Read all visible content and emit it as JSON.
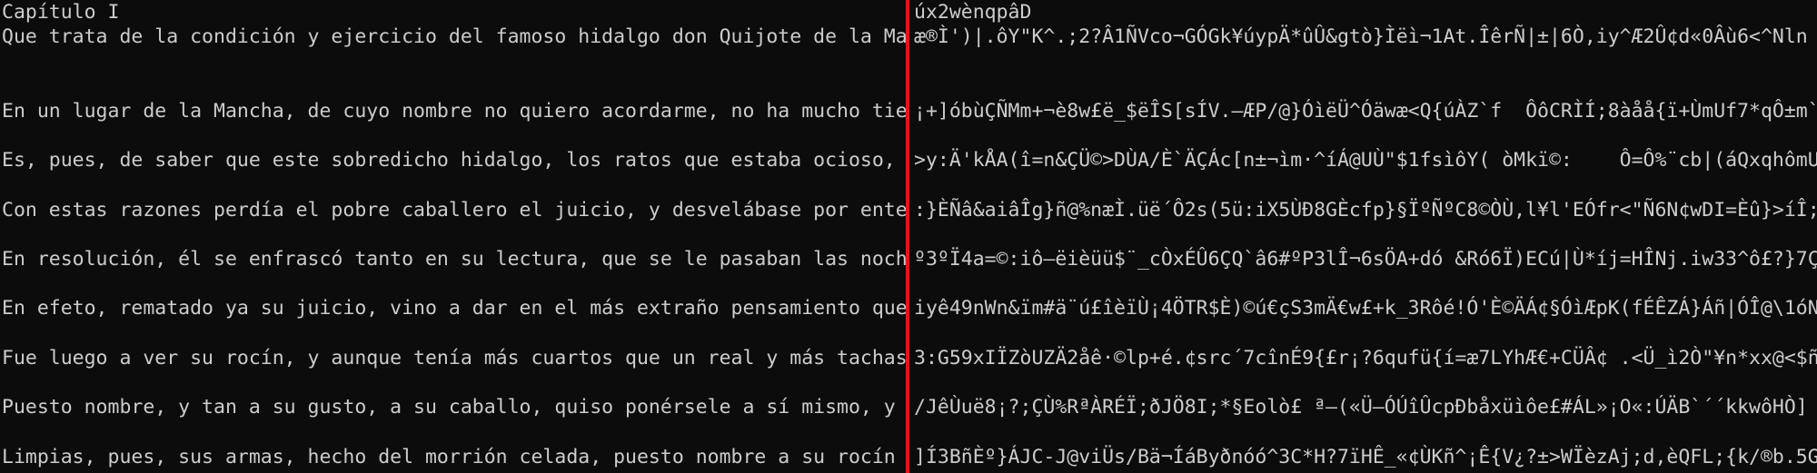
{
  "colors": {
    "background": "#0c0c0c",
    "text": "#cccccc",
    "divider": "#e81123"
  },
  "left_pane": {
    "lines": [
      "Capítulo I",
      "Que trata de la condición y ejercicio del famoso hidalgo don Quijote de la Ma",
      "",
      "",
      "En un lugar de la Mancha, de cuyo nombre no quiero acordarme, no ha mucho tie",
      "",
      "Es, pues, de saber que este sobredicho hidalgo, los ratos que estaba ocioso, ",
      "",
      "Con estas razones perdía el pobre caballero el juicio, y desvelábase por ente",
      "",
      "En resolución, él se enfrascó tanto en su lectura, que se le pasaban las noch",
      "",
      "En efeto, rematado ya su juicio, vino a dar en el más extraño pensamiento que",
      "",
      "Fue luego a ver su rocín, y aunque tenía más cuartos que un real y más tachas",
      "",
      "Puesto nombre, y tan a su gusto, a su caballo, quiso ponérsele a sí mismo, y ",
      "",
      "Limpias, pues, sus armas, hecho del morrión celada, puesto nombre a su rocín "
    ]
  },
  "right_pane": {
    "lines": [
      "úx2wènqpâD",
      "æ®Ì')|.ôY\"K^.;2?Â1ÑVco¬GÓGk¥úypÄ*ûÛ&gtò}Ìëì¬1At.ÎêrÑ|±|6Ò,iy^Æ2Û¢d«0Âù6<^Nln",
      "",
      "",
      "¡+]óbùÇÑMm+¬è8w£ë_$ëÎS[sÍV.—ÆP/@}ÓìëÜ^Óäwæ<Q{úÀZ`f  ÔôCRÌÍ;8àåå{ï+ÙmUf7*qÔ±m`",
      "",
      ">y:Ä'kÅA(î=n&ÇÜ©>DÙA/È`ÄÇÁc[n±¬ìm·^íÁ@UÙ\"$1fsìôY( òMkï©:    Ô=Ô%¨cb|(áQxqhômU",
      "",
      ":}ÈÑâ&aiâÎg}ñ@%næÌ.üë´Ô2s(5ü:iX5ÙÐ8GÈcfp}§ÏºÑºC8©ÒÙ,l¥l'EÓfr<\"Ñ6N¢wDI=Èû}>íÎ;",
      "",
      "º3ºÏ4a=©:iô—ëièüü$¨_cÒxÉÛ6ÇQ`â6#ºP3lÎ¬6sÖA+dó &Ró6Ï)ECú|Ù*íj=HÎNj.iw33^ô£?}7Ç",
      "",
      "iyê49nWn&ïm#ä¨ú£îèïÙ¡4ÖTR$È)©ú€çS3mÄ€w£+k_3Rôé!Ó'È©ÄÁ¢§ÓìÆpK(fÉÊZÁ}Áñ|ÓÎ@\\1óN",
      "",
      "3:G59xIÏZòUZÄ2åê·©lp+é.¢src´7cînÉ9{£r¡?6qufü{í=æ7LYhÆ€+CÜÂ¢ .<Ü_ì2Ò\"¥n*xx@<$ñ",
      "",
      "/JêÙuë8¡?;ÇÙ%RªÀRÉÏ;ðJÖ8I;*§Eolò£ ª—(«Ü—ÓÚîÛcpÐbåxüìôe£#ÁL»¡O«:ÚÄB`´´kkwôHÒ]",
      "",
      "]Í3BñÈº}ÁJC-J@viÜs/Bä¬ÍáByðnóó^3C*H?7ïHÊ_«¢ÙKñ^¡Ê{V¿?±>WÏèzAj;d,èQFL;{k/®b.5G"
    ]
  }
}
